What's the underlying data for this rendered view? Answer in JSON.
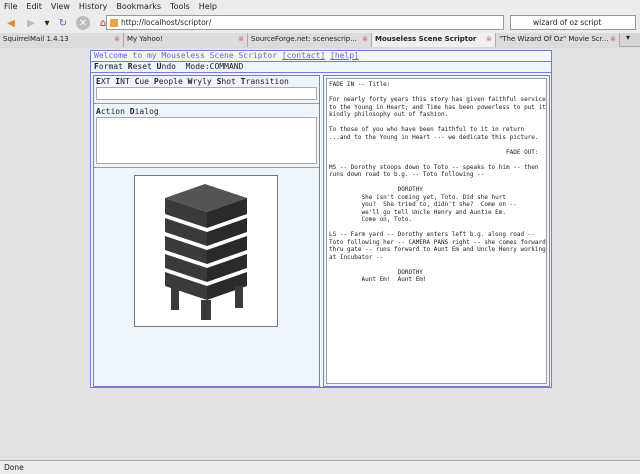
{
  "browser": {
    "menu": [
      "File",
      "Edit",
      "View",
      "History",
      "Bookmarks",
      "Tools",
      "Help"
    ],
    "url": "http://localhost/scriptor/",
    "search": "wizard of oz script",
    "tabs": [
      "SquirrelMail 1.4.13",
      "My Yahoo!",
      "SourceForge.net: scenescrip...",
      "Mouseless Scene Scriptor",
      "\"The Wizard Of Oz\" Movie Scr..."
    ],
    "status": "Done"
  },
  "header": {
    "welcome": "Welcome to my Mouseless Scene Scriptor",
    "contact": "[contact]",
    "help": "[help]"
  },
  "menu": {
    "format": "Format",
    "reset": "Reset",
    "undo": "Undo",
    "mode": "Mode:COMMAND"
  },
  "elements": {
    "items": [
      "EXT",
      "INT",
      "Cue",
      "People",
      "Wryly",
      "Shot",
      "Transition"
    ]
  },
  "actions": {
    "items": [
      "Action",
      "Dialog"
    ]
  },
  "script": "FADE IN -- Title:\n\nFor nearly forty years this story has given faithful service\nto the Young in Heart; and Time has been powerless to put its\nkindly philosophy out of fashion.\n\nTo those of you who have been faithful to it in return\n...and to the Young in Heart --- we dedicate this picture.\n\n                                                 FADE OUT:\n\nMS -- Dorothy stoops down to Toto -- speaks to him -- then\nruns down road to b.g. -- Toto following --\n\n                   DOROTHY\n         She isn't coming yet, Toto. Did she hurt\n         you?  She tried to, didn't she?  Come on --\n         we'll go tell Uncle Henry and Auntie Em.\n         Come on, Toto.\n\nLS -- Farm yard -- Dorothy enters left b.g. along road --\nToto following her -- CAMERA PANS right -- she comes forward\nthru gate -- runs forward to Aunt Em and Uncle Henry working\nat Incubator --\n\n                   DOROTHY\n         Aunt Em!  Aunt Em!"
}
